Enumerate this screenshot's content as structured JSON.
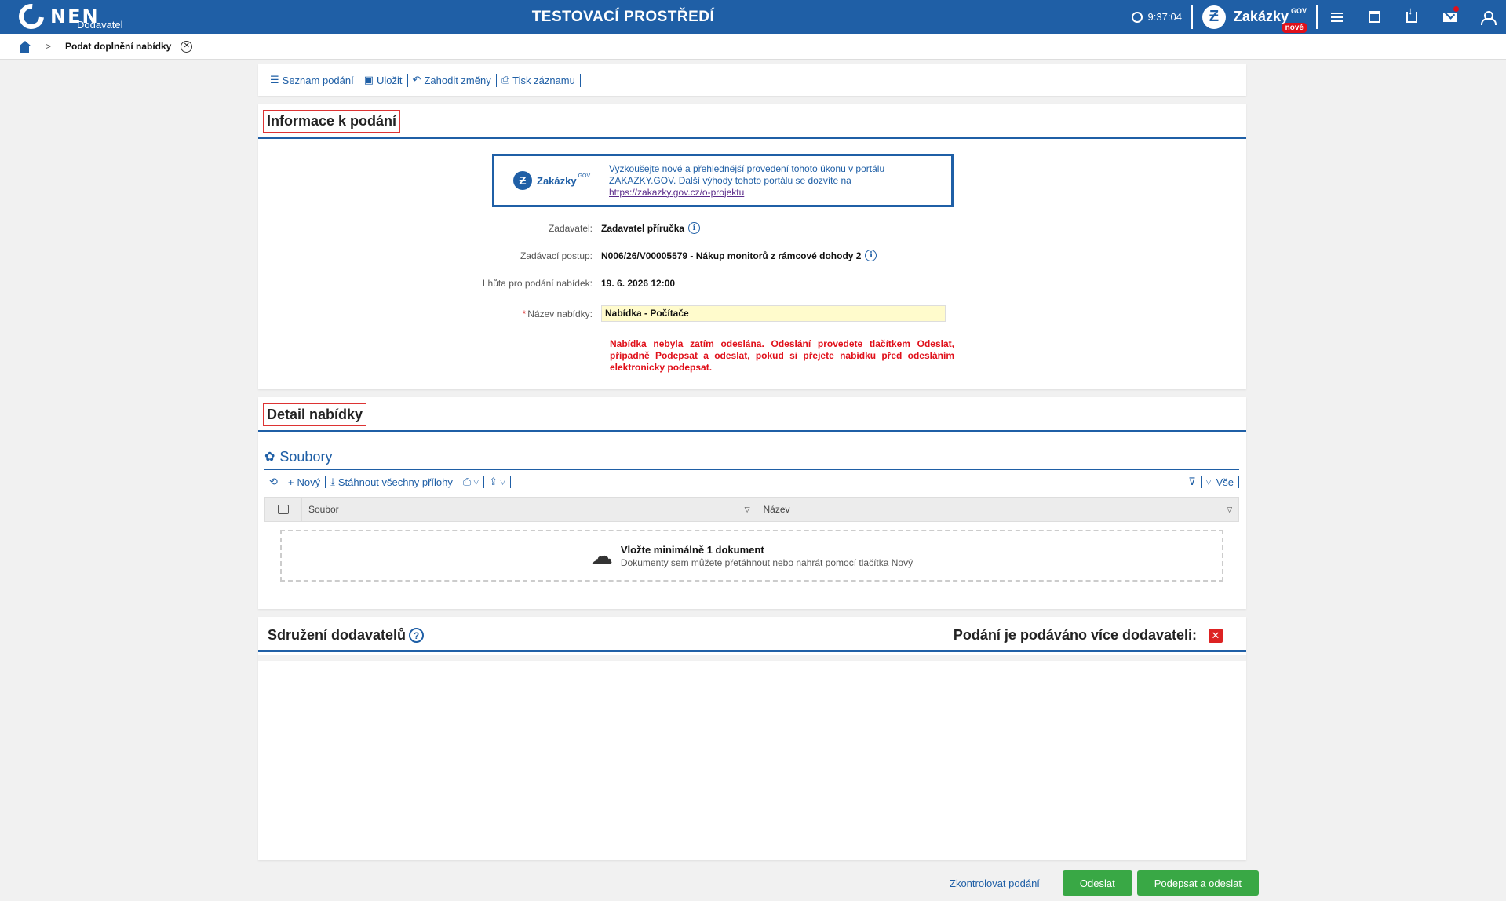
{
  "topbar": {
    "logo_text": "NEN",
    "logo_sub": "Dodavatel",
    "env_title": "TESTOVACÍ PROSTŘEDÍ",
    "clock": "9:37:04",
    "zakazky": "Zakázky",
    "zakazky_sup": "GOV",
    "nove_badge": "nové"
  },
  "breadcrumb": {
    "current": "Podat doplnění nabídky"
  },
  "toolbar": {
    "items": [
      "Seznam podání",
      "Uložit",
      "Zahodit změny",
      "Tisk záznamu"
    ]
  },
  "info": {
    "title": "Informace k podání",
    "promo_logo": "Zakázky",
    "promo_logo_sup": "GOV",
    "promo_line1": "Vyzkoušejte nové a přehlednější provedení tohoto úkonu v portálu",
    "promo_line2": "ZAKAZKY.GOV. Další výhody tohoto portálu se dozvíte na",
    "promo_link": "https://zakazky.gov.cz/o-projektu",
    "zadavatel_label": "Zadavatel:",
    "zadavatel_value": "Zadavatel příručka",
    "postup_label": "Zadávací postup:",
    "postup_value": "N006/26/V00005579 - Nákup monitorů z rámcové dohody 2",
    "lhuta_label": "Lhůta pro podání nabídek:",
    "lhuta_value": "19. 6. 2026 12:00",
    "nazev_label": "Název nabídky:",
    "nazev_value": "Nabídka - Počítače",
    "warning": "Nabídka nebyla zatím odeslána. Odeslání provedete tlačítkem Odeslat, případně Podepsat a odeslat, pokud si přejete nabídku před odesláním elektronicky podepsat."
  },
  "detail": {
    "title": "Detail nabídky",
    "files_title": "Soubory",
    "tool_new": "Nový",
    "tool_download_all": "Stáhnout všechny přílohy",
    "tool_all": "Vše",
    "col_file": "Soubor",
    "col_name": "Název",
    "drop_title": "Vložte minimálně 1 dokument",
    "drop_sub": "Dokumenty sem můžete přetáhnout nebo nahrát pomocí tlačítka Nový"
  },
  "sdruzeni": {
    "title": "Sdružení dodavatelů",
    "right_label": "Podání je podáváno více dodavateli:"
  },
  "footer": {
    "check": "Zkontrolovat podání",
    "send": "Odeslat",
    "sign_send": "Podepsat a odeslat"
  },
  "colors": {
    "primary": "#1f5fa6",
    "green": "#39a845",
    "error": "#e0101a"
  }
}
